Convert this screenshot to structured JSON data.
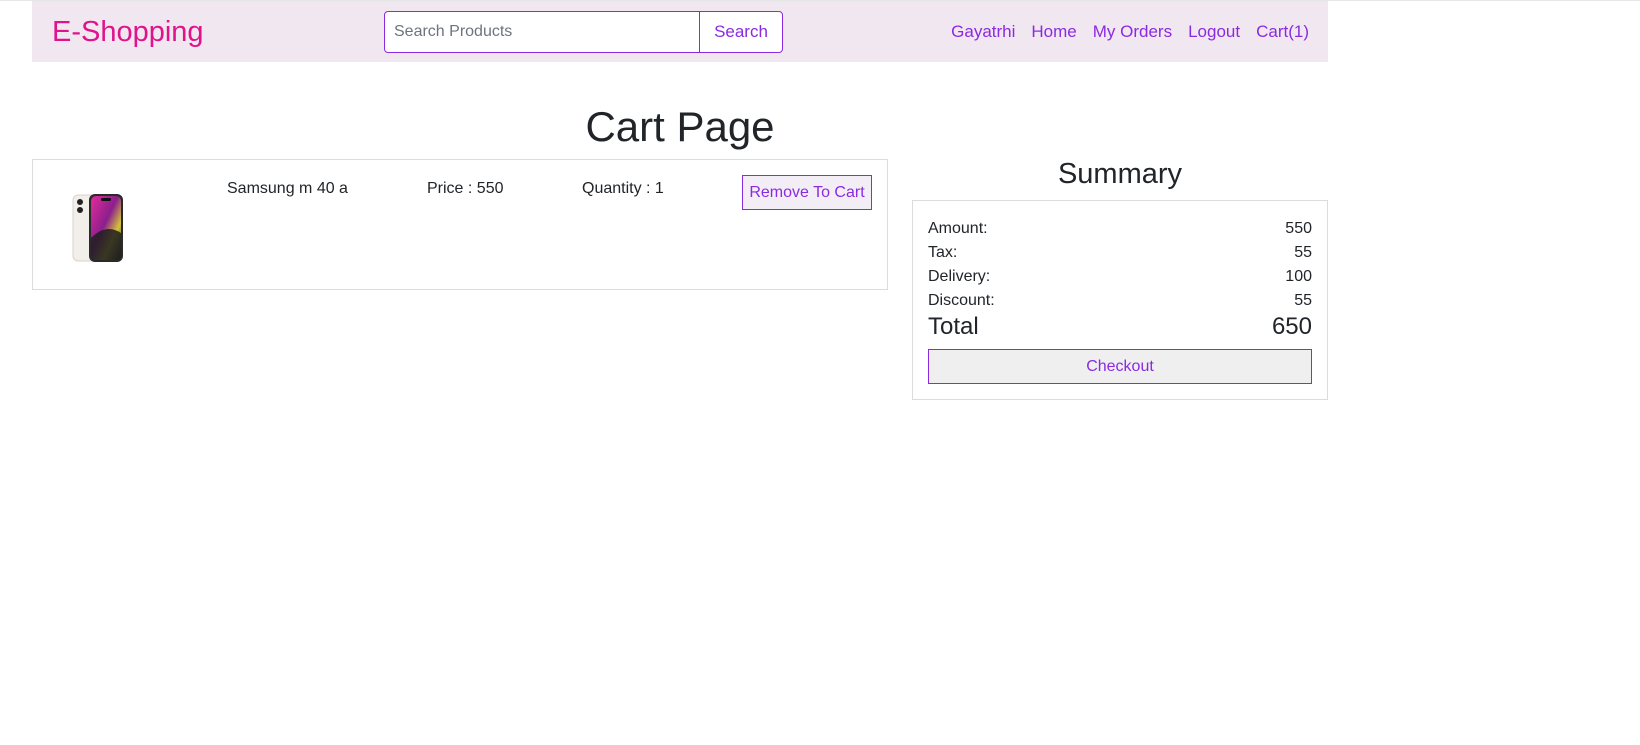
{
  "navbar": {
    "brand": "E-Shopping",
    "search": {
      "placeholder": "Search Products",
      "value": "",
      "button_label": "Search"
    },
    "links": [
      "Gayatrhi",
      "Home",
      "My Orders",
      "Logout",
      "Cart(1)"
    ]
  },
  "page": {
    "title": "Cart Page"
  },
  "cart": {
    "items": [
      {
        "name": "Samsung m 40 a",
        "price": "Price : 550",
        "quantity": "Quantity : 1",
        "remove_label": "Remove To Cart",
        "image_icon": "smartphone-icon"
      }
    ]
  },
  "summary": {
    "title": "Summary",
    "rows": [
      {
        "label": "Amount:",
        "value": "550"
      },
      {
        "label": "Tax:",
        "value": "55"
      },
      {
        "label": "Delivery:",
        "value": "100"
      },
      {
        "label": "Discount:",
        "value": "55"
      }
    ],
    "total": {
      "label": "Total",
      "value": "650"
    },
    "checkout_label": "Checkout"
  },
  "colors": {
    "accent": "#8a2be2",
    "brand": "#e0138c",
    "navbar_bg": "#f1e7f0"
  }
}
